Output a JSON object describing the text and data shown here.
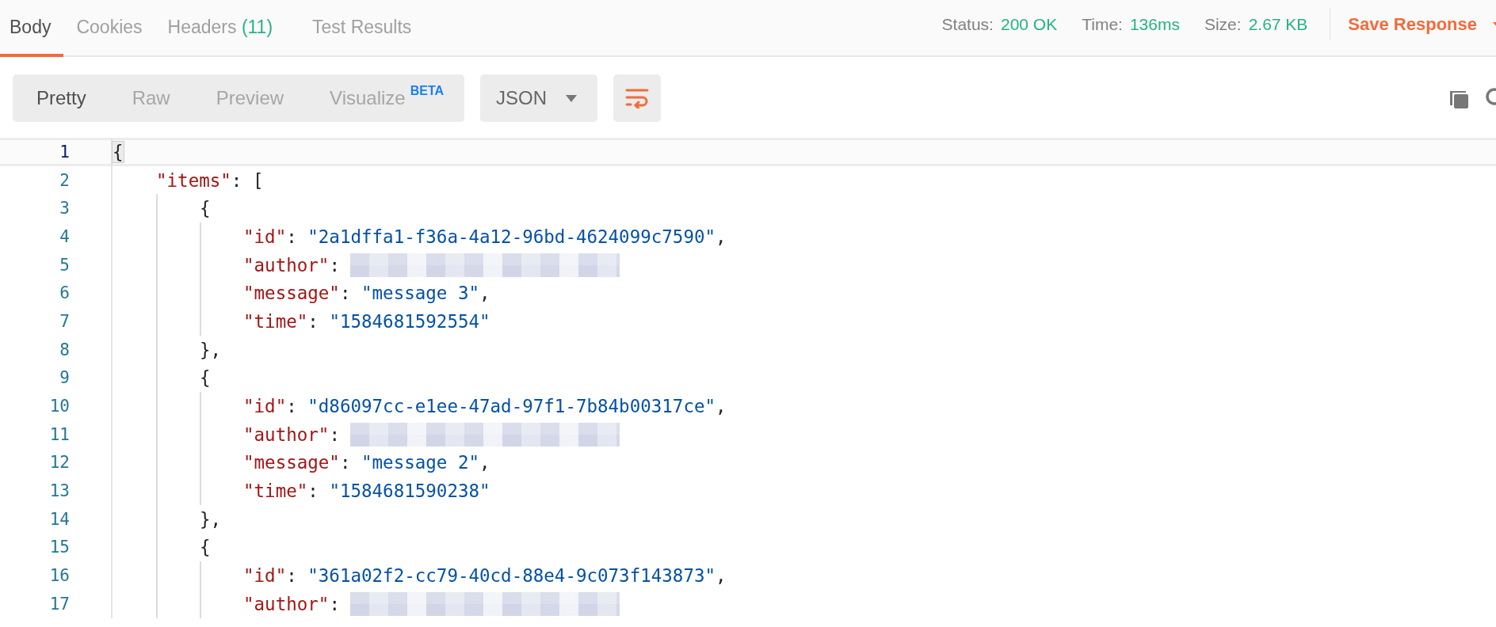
{
  "tabs": [
    {
      "label": "Body",
      "selected": true
    },
    {
      "label": "Cookies",
      "selected": false
    },
    {
      "label": "Headers",
      "count": "(11)",
      "selected": false
    },
    {
      "label": "Test Results",
      "selected": false
    }
  ],
  "stats": [
    {
      "label": "Status:",
      "value": "200 OK"
    },
    {
      "label": "Time:",
      "value": "136ms"
    },
    {
      "label": "Size:",
      "value": "2.67 KB"
    }
  ],
  "save_response": {
    "label": "Save Response"
  },
  "view_modes": [
    {
      "label": "Pretty",
      "selected": true
    },
    {
      "label": "Raw",
      "selected": false
    },
    {
      "label": "Preview",
      "selected": false
    },
    {
      "label": "Visualize",
      "badge": "BETA",
      "selected": false
    }
  ],
  "format_dropdown": {
    "value": "JSON"
  },
  "wrap_lines": {
    "on": true
  },
  "code_lines": [
    {
      "number": "1",
      "active": true,
      "tokens": [
        {
          "kind": "punct",
          "text": "{"
        }
      ],
      "children": [
        {
          "number": "2",
          "active": false,
          "tokens": [
            {
              "kind": "key",
              "text": "\"items\""
            },
            {
              "kind": "punct",
              "text": ": ["
            }
          ],
          "children": [
            {
              "number": "3",
              "active": false,
              "tokens": [
                {
                  "kind": "punct",
                  "text": "{"
                }
              ],
              "children": [
                {
                  "number": "4",
                  "active": false,
                  "tokens": [
                    {
                      "kind": "key",
                      "text": "\"id\""
                    },
                    {
                      "kind": "punct",
                      "text": ": "
                    },
                    {
                      "kind": "string",
                      "text": "\"2a1dffa1-f36a-4a12-96bd-4624099c7590\""
                    },
                    {
                      "kind": "punct",
                      "text": ","
                    }
                  ]
                },
                {
                  "number": "5",
                  "active": false,
                  "tokens": [
                    {
                      "kind": "key",
                      "text": "\"author\""
                    },
                    {
                      "kind": "punct",
                      "text": ": "
                    },
                    {
                      "kind": "redacted"
                    }
                  ]
                },
                {
                  "number": "6",
                  "active": false,
                  "tokens": [
                    {
                      "kind": "key",
                      "text": "\"message\""
                    },
                    {
                      "kind": "punct",
                      "text": ": "
                    },
                    {
                      "kind": "string",
                      "text": "\"message 3\""
                    },
                    {
                      "kind": "punct",
                      "text": ","
                    }
                  ]
                },
                {
                  "number": "7",
                  "active": false,
                  "tokens": [
                    {
                      "kind": "key",
                      "text": "\"time\""
                    },
                    {
                      "kind": "punct",
                      "text": ": "
                    },
                    {
                      "kind": "string",
                      "text": "\"1584681592554\""
                    }
                  ]
                }
              ]
            },
            {
              "number": "8",
              "active": false,
              "tokens": [
                {
                  "kind": "punct",
                  "text": "},"
                }
              ]
            },
            {
              "number": "9",
              "active": false,
              "tokens": [
                {
                  "kind": "punct",
                  "text": "{"
                }
              ],
              "children": [
                {
                  "number": "10",
                  "active": false,
                  "tokens": [
                    {
                      "kind": "key",
                      "text": "\"id\""
                    },
                    {
                      "kind": "punct",
                      "text": ": "
                    },
                    {
                      "kind": "string",
                      "text": "\"d86097cc-e1ee-47ad-97f1-7b84b00317ce\""
                    },
                    {
                      "kind": "punct",
                      "text": ","
                    }
                  ]
                },
                {
                  "number": "11",
                  "active": false,
                  "tokens": [
                    {
                      "kind": "key",
                      "text": "\"author\""
                    },
                    {
                      "kind": "punct",
                      "text": ": "
                    },
                    {
                      "kind": "redacted"
                    }
                  ]
                },
                {
                  "number": "12",
                  "active": false,
                  "tokens": [
                    {
                      "kind": "key",
                      "text": "\"message\""
                    },
                    {
                      "kind": "punct",
                      "text": ": "
                    },
                    {
                      "kind": "string",
                      "text": "\"message 2\""
                    },
                    {
                      "kind": "punct",
                      "text": ","
                    }
                  ]
                },
                {
                  "number": "13",
                  "active": false,
                  "tokens": [
                    {
                      "kind": "key",
                      "text": "\"time\""
                    },
                    {
                      "kind": "punct",
                      "text": ": "
                    },
                    {
                      "kind": "string",
                      "text": "\"1584681590238\""
                    }
                  ]
                }
              ]
            },
            {
              "number": "14",
              "active": false,
              "tokens": [
                {
                  "kind": "punct",
                  "text": "},"
                }
              ]
            },
            {
              "number": "15",
              "active": false,
              "tokens": [
                {
                  "kind": "punct",
                  "text": "{"
                }
              ],
              "children": [
                {
                  "number": "16",
                  "active": false,
                  "tokens": [
                    {
                      "kind": "key",
                      "text": "\"id\""
                    },
                    {
                      "kind": "punct",
                      "text": ": "
                    },
                    {
                      "kind": "string",
                      "text": "\"361a02f2-cc79-40cd-88e4-9c073f143873\""
                    },
                    {
                      "kind": "punct",
                      "text": ","
                    }
                  ]
                },
                {
                  "number": "17",
                  "active": false,
                  "tokens": [
                    {
                      "kind": "key",
                      "text": "\"author\""
                    },
                    {
                      "kind": "punct",
                      "text": ": "
                    },
                    {
                      "kind": "redacted"
                    }
                  ]
                }
              ]
            }
          ]
        }
      ]
    }
  ]
}
